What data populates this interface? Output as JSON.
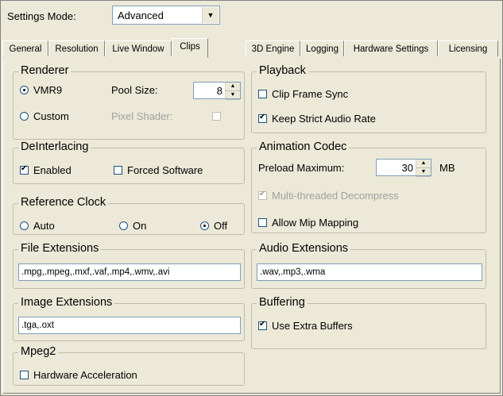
{
  "settings_mode": {
    "label": "Settings Mode:",
    "value": "Advanced"
  },
  "tabs": [
    "General",
    "Resolution",
    "Live Window",
    "Clips",
    "3D Engine",
    "Logging",
    "Hardware Settings",
    "Licensing"
  ],
  "active_tab": "Clips",
  "renderer": {
    "title": "Renderer",
    "vmr9": "VMR9",
    "custom": "Custom",
    "pool_size_label": "Pool Size:",
    "pool_size_value": "8",
    "pixel_shader_label": "Pixel Shader:",
    "selected": "VMR9"
  },
  "deinterlacing": {
    "title": "DeInterlacing",
    "enabled": "Enabled",
    "forced_software": "Forced Software"
  },
  "reference_clock": {
    "title": "Reference Clock",
    "auto": "Auto",
    "on": "On",
    "off": "Off",
    "selected": "Off"
  },
  "file_extensions": {
    "title": "File Extensions",
    "value": ".mpg,.mpeg,.mxf,.vaf,.mp4,.wmv,.avi"
  },
  "image_extensions": {
    "title": "Image Extensions",
    "value": ".tga,.oxt"
  },
  "mpeg2": {
    "title": "Mpeg2",
    "hardware_acceleration": "Hardware Acceleration"
  },
  "playback": {
    "title": "Playback",
    "clip_frame_sync": "Clip Frame Sync",
    "keep_strict_audio_rate": "Keep Strict Audio Rate"
  },
  "animation_codec": {
    "title": "Animation Codec",
    "preload_label": "Preload Maximum:",
    "preload_value": "30",
    "preload_unit": "MB",
    "multithreaded": "Multi-threaded Decompress",
    "allow_mip": "Allow Mip Mapping"
  },
  "audio_extensions": {
    "title": "Audio Extensions",
    "value": ".wav,.mp3,.wma"
  },
  "buffering": {
    "title": "Buffering",
    "use_extra_buffers": "Use Extra Buffers"
  }
}
